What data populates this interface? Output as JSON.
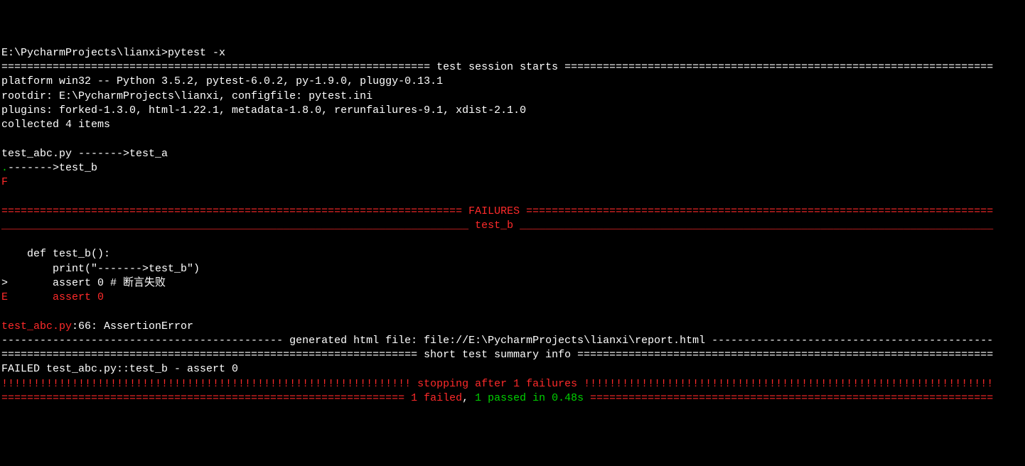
{
  "prompt": "E:\\PycharmProjects\\lianxi>pytest -x",
  "session_header_label": " test session starts ",
  "platform_line": "platform win32 -- Python 3.5.2, pytest-6.0.2, py-1.9.0, pluggy-0.13.1",
  "rootdir_line": "rootdir: E:\\PycharmProjects\\lianxi, configfile: pytest.ini",
  "plugins_line": "plugins: forked-1.3.0, html-1.22.1, metadata-1.8.0, rerunfailures-9.1, xdist-2.1.0",
  "collected_line": "collected 4 items",
  "blank": "",
  "test_a_prefix": "test_abc.py ",
  "test_a_arrow": "------->test_a",
  "pass_dot": ".",
  "test_b_arrow": "------->test_b",
  "fail_f": "F",
  "failures_header_label": " FAILURES ",
  "test_b_header_label": " test_b ",
  "code_line1": "    def test_b():",
  "code_line2": "        print(\"------->test_b\")",
  "code_line3_prefix": ">",
  "code_line3_body": "       assert 0 # 断言失败",
  "err_prefix": "E",
  "err_body": "       assert 0",
  "file_ref": "test_abc.py",
  "file_ref_rest": ":66: AssertionError",
  "generated_label": " generated html file: file://E:\\PycharmProjects\\lianxi\\report.html ",
  "summary_label": " short test summary info ",
  "failed_line": "FAILED test_abc.py::test_b - assert 0",
  "stopping_label": " stopping after 1 failures ",
  "result_failed": "1 failed",
  "result_comma": ", ",
  "result_passed": "1 passed",
  "result_time": " in 0.48s",
  "sep_eq": "=",
  "sep_under": "_",
  "sep_dash": "-",
  "sep_bang": "!"
}
